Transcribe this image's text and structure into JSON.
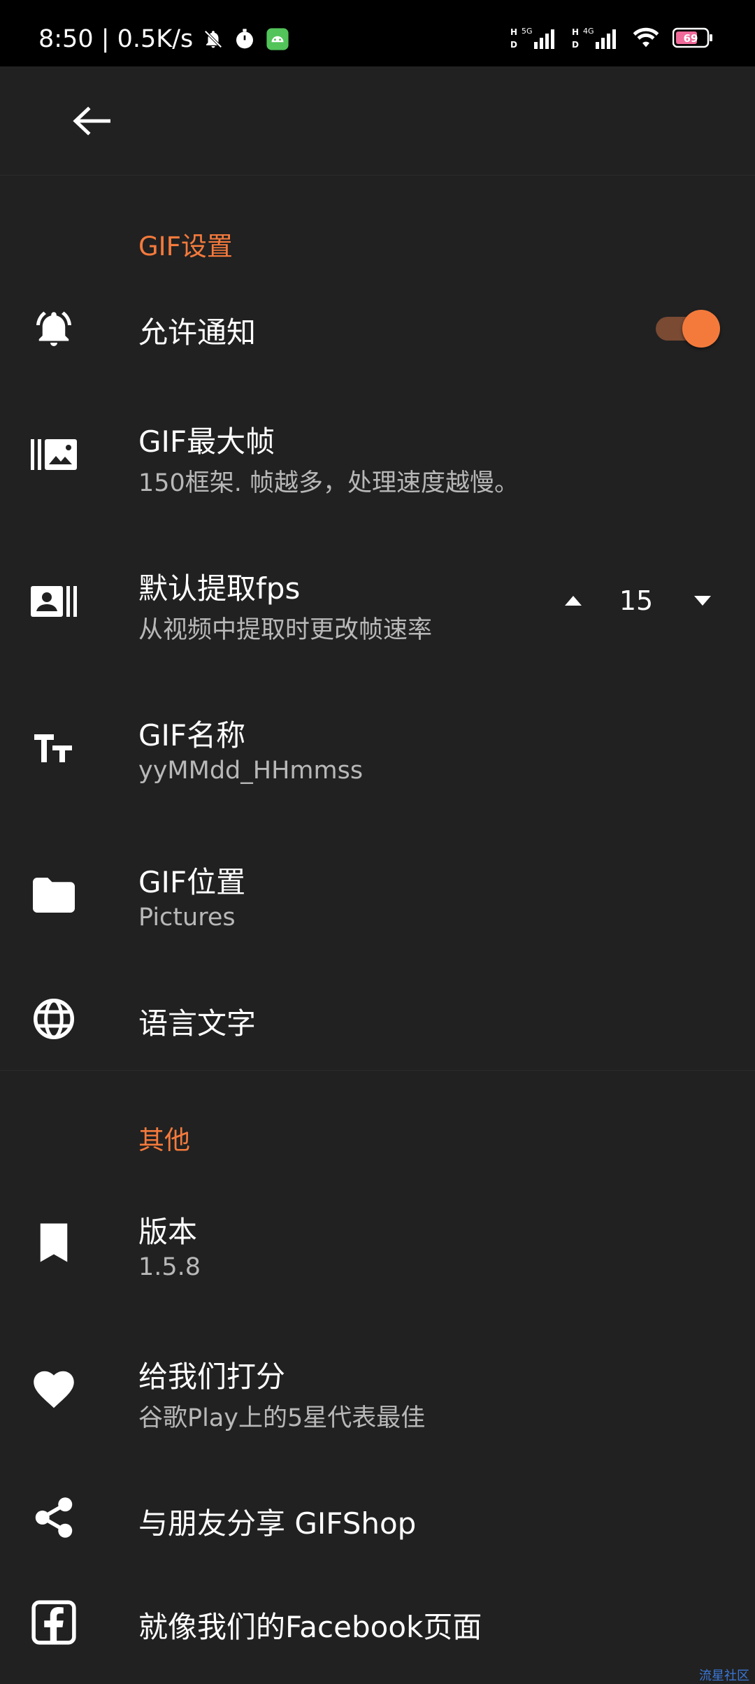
{
  "status_bar": {
    "time_speed": "8:50 | 0.5K/s",
    "net1": "5G",
    "net2": "4G",
    "battery": "69"
  },
  "settings": {
    "gif_section_title": "GIF设置",
    "allow_notifications": {
      "title": "允许通知",
      "enabled": true
    },
    "max_frames": {
      "title": "GIF最大帧",
      "subtitle": "150框架. 帧越多，处理速度越慢。"
    },
    "default_fps": {
      "title": "默认提取fps",
      "subtitle": "从视频中提取时更改帧速率",
      "value": "15"
    },
    "gif_name": {
      "title": "GIF名称",
      "subtitle": "yyMMdd_HHmmss"
    },
    "gif_location": {
      "title": "GIF位置",
      "subtitle": "Pictures"
    },
    "language": {
      "title": "语言文字"
    },
    "other_section_title": "其他",
    "version": {
      "title": "版本",
      "subtitle": "1.5.8"
    },
    "rate": {
      "title": "给我们打分",
      "subtitle": "谷歌Play上的5星代表最佳"
    },
    "share": {
      "title": "与朋友分享 GIFShop"
    },
    "facebook": {
      "title": "就像我们的Facebook页面"
    }
  },
  "colors": {
    "accent": "#f47a3c",
    "background": "#212121",
    "subtitle": "#b8b8b8"
  },
  "watermark": "流星社区"
}
